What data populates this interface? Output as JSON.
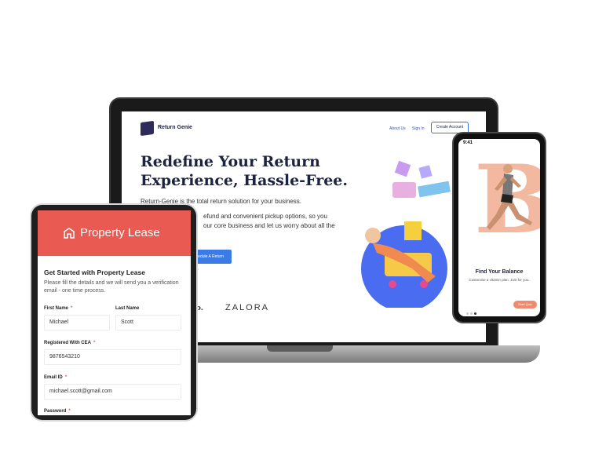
{
  "laptop": {
    "brand": "Return Genie",
    "nav": [
      "About Us",
      "Sign In"
    ],
    "create_account": "Create Account",
    "headline_line1": "Redefine Your Return",
    "headline_line2": "Experience, Hassle-Free.",
    "subline": "Return-Genie is the total return solution for your business.",
    "desc_line1": "efund and convenient pickup options, so you",
    "desc_line2": "our core business and let us worry about all the",
    "cta": "hedule A Return",
    "cta_note": "ores",
    "partner1": "clo.",
    "partner2": "ZALORA"
  },
  "phone": {
    "time": "9:41",
    "title": "Find Your Balance",
    "subtitle": "Customise a vitamin plan. Just for you.",
    "start_button": "Start Quiz",
    "big_letter": "B"
  },
  "tablet": {
    "header_title": "Property Lease",
    "heading": "Get Started with Property Lease",
    "description": "Please fill the details and we will send you a verification email - one time process.",
    "fields": {
      "first_name_label": "First Name",
      "first_name_value": "Michael",
      "last_name_label": "Last Name",
      "last_name_value": "Scott",
      "cea_label": "Registered With CEA",
      "cea_value": "9876543210",
      "email_label": "Email ID",
      "email_value": "michael.scott@gmail.com",
      "password_label": "Password"
    },
    "required_mark": "*"
  },
  "colors": {
    "accent_red": "#e85a52",
    "brand_navy": "#1d2240",
    "cta_blue": "#3a7be8",
    "peach": "#f2b9a0"
  }
}
